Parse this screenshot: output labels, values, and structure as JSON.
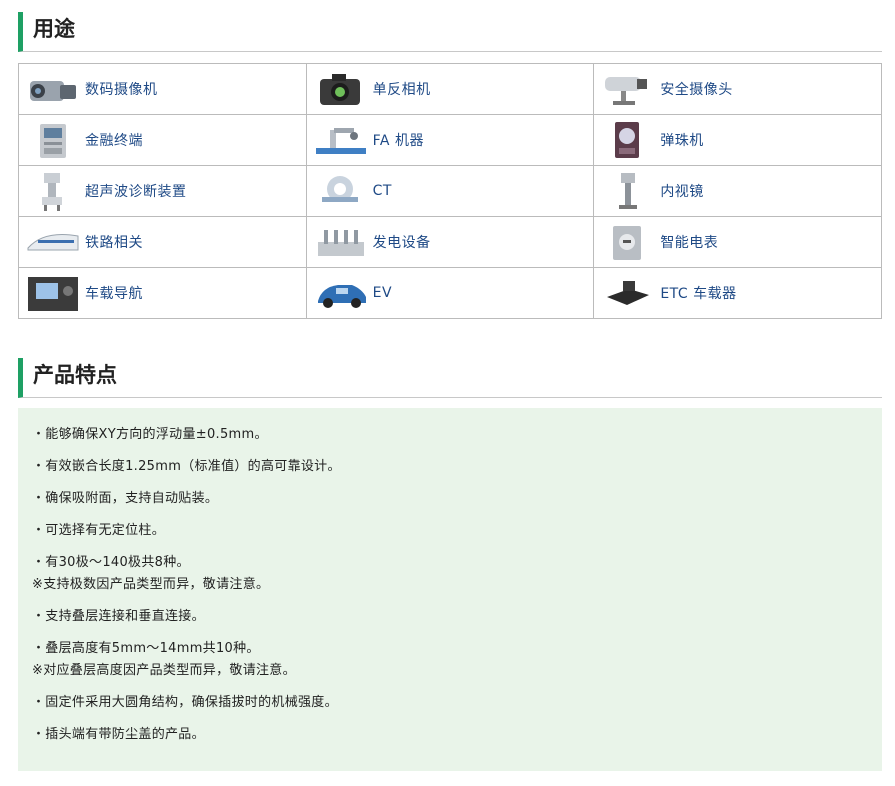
{
  "usage_section": {
    "title": "用途",
    "rows": [
      [
        {
          "label": "数码摄像机",
          "icon": "camcorder-icon"
        },
        {
          "label": "单反相机",
          "icon": "dslr-camera-icon"
        },
        {
          "label": "安全摄像头",
          "icon": "security-camera-icon"
        }
      ],
      [
        {
          "label": "金融终端",
          "icon": "financial-terminal-icon"
        },
        {
          "label": "FA 机器",
          "icon": "fa-robot-icon"
        },
        {
          "label": "弹珠机",
          "icon": "pachinko-machine-icon"
        }
      ],
      [
        {
          "label": "超声波诊断装置",
          "icon": "ultrasound-device-icon"
        },
        {
          "label": "CT",
          "icon": "ct-scanner-icon"
        },
        {
          "label": "内视镜",
          "icon": "endoscope-icon"
        }
      ],
      [
        {
          "label": "铁路相关",
          "icon": "bullet-train-icon"
        },
        {
          "label": "发电设备",
          "icon": "power-plant-icon"
        },
        {
          "label": "智能电表",
          "icon": "smart-meter-icon"
        }
      ],
      [
        {
          "label": "车载导航",
          "icon": "car-navigation-icon"
        },
        {
          "label": "EV",
          "icon": "electric-vehicle-icon"
        },
        {
          "label": "ETC 车载器",
          "icon": "etc-unit-icon"
        }
      ]
    ]
  },
  "features_section": {
    "title": "产品特点",
    "items": [
      [
        "・能够确保XY方向的浮动量±0.5mm。"
      ],
      [
        "・有效嵌合长度1.25mm（标准值）的高可靠设计。"
      ],
      [
        "・确保吸附面，支持自动贴装。"
      ],
      [
        "・可选择有无定位柱。"
      ],
      [
        "・有30极～140极共8种。",
        "※支持极数因产品类型而异，敬请注意。"
      ],
      [
        "・支持叠层连接和垂直连接。"
      ],
      [
        "・叠层高度有5mm～14mm共10种。",
        "※对应叠层高度因产品类型而异，敬请注意。"
      ],
      [
        "・固定件采用大圆角结构，确保插拔时的机械强度。"
      ],
      [
        "・插头端有带防尘盖的产品。"
      ]
    ]
  },
  "colors": {
    "accent": "#1ea064",
    "link_text": "#1f4a86",
    "feature_bg": "#e9f4e9"
  }
}
